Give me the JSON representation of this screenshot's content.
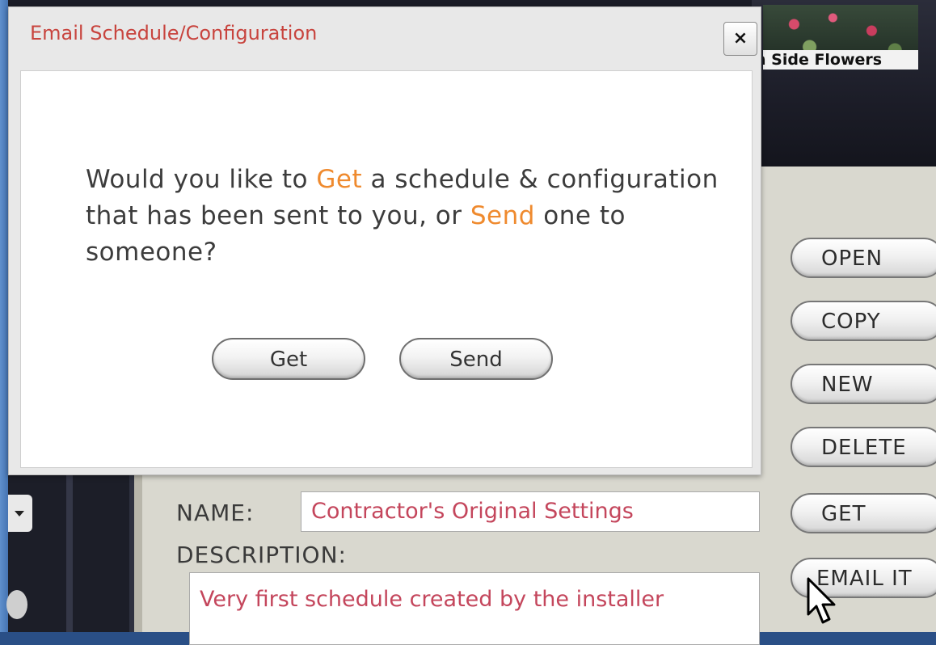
{
  "dialog": {
    "title": "Email Schedule/Configuration",
    "close_label": "×",
    "question": {
      "part1": "Would you like to ",
      "get_word": "Get",
      "part2": " a schedule & configuration that has been sent to you, or ",
      "send_word": "Send",
      "part3": " one to someone?"
    },
    "buttons": {
      "get": "Get",
      "send": "Send"
    }
  },
  "thumbnail": {
    "label": "h Side Flowers"
  },
  "side_buttons": {
    "open": "OPEN",
    "copy": "COPY",
    "new": "NEW",
    "delete": "DELETE",
    "get": "GET",
    "email_it": "EMAIL IT"
  },
  "form": {
    "name_label": "NAME:",
    "name_value": "Contractor's Original Settings",
    "description_label": "DESCRIPTION:",
    "description_value": "Very first schedule created by the installer"
  },
  "colors": {
    "title_red": "#c8443e",
    "accent_orange": "#ef8a2e",
    "field_text": "#c4465c"
  }
}
